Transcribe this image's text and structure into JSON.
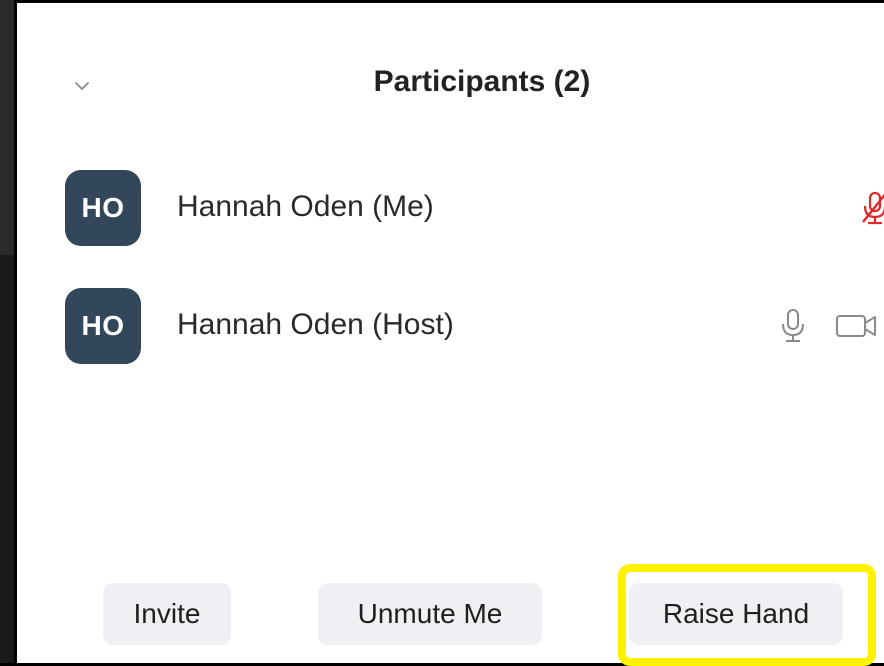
{
  "panel": {
    "title": "Participants (2)"
  },
  "participants": [
    {
      "initials": "HO",
      "name": "Hannah Oden (Me)",
      "mic_icon": "mic-muted-icon",
      "avatar_color": "#33475b",
      "mic_color": "#e02828"
    },
    {
      "initials": "HO",
      "name": "Hannah Oden (Host)",
      "mic_icon": "mic-icon",
      "video_icon": "video-camera-icon",
      "avatar_color": "#33475b"
    }
  ],
  "footer": {
    "invite_label": "Invite",
    "unmute_label": "Unmute Me",
    "raise_hand_label": "Raise Hand"
  },
  "colors": {
    "highlight": "#fff200",
    "button_bg": "#eef0f4"
  }
}
